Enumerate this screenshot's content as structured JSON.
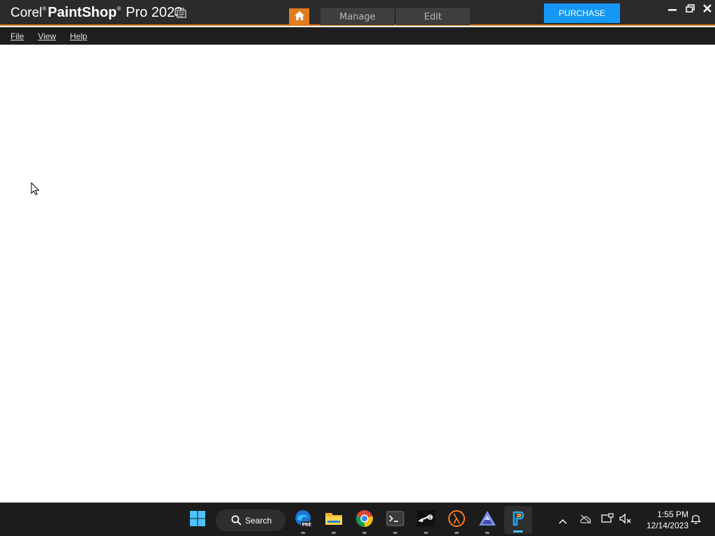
{
  "app": {
    "brand_company": "Corel",
    "brand_reg": "®",
    "brand_product": "PaintShop",
    "brand_version": "Pro 2023"
  },
  "tabs": {
    "manage_label": "Manage",
    "edit_label": "Edit"
  },
  "purchase_label": "PURCHASE",
  "menu": {
    "items": [
      {
        "label": "File"
      },
      {
        "label": "View"
      },
      {
        "label": "Help"
      }
    ]
  },
  "taskbar": {
    "search_label": "Search",
    "edge_badge": "PRE",
    "clock_time": "1:55 PM",
    "clock_date": "12/14/2023"
  },
  "colors": {
    "accent_orange": "#e07b1f",
    "purchase_blue": "#1597f5",
    "titlebar_bg": "#2b2b2b",
    "menubar_bg": "#1e1e1e",
    "taskbar_bg": "#1c1c1c"
  },
  "icons": [
    "home-icon",
    "minimize-icon",
    "restore-icon",
    "close-icon",
    "windows-start-icon",
    "search-icon",
    "edge-icon",
    "file-explorer-icon",
    "chrome-icon",
    "terminal-icon",
    "steam-icon",
    "half-life-icon",
    "affinity-icon",
    "paintshop-icon",
    "chevron-up-icon",
    "onedrive-icon",
    "display-icon",
    "speaker-muted-icon",
    "notification-bell-icon"
  ]
}
